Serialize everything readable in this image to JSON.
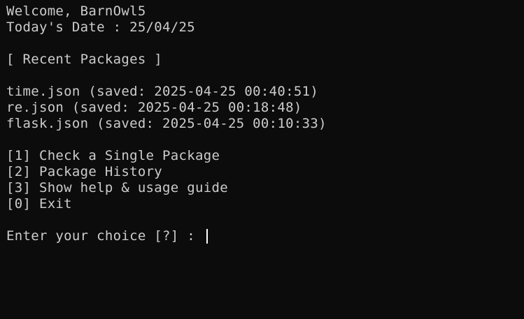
{
  "header": {
    "welcome": "Welcome, BarnOwl5",
    "date_line": "Today's Date : 25/04/25"
  },
  "recent": {
    "heading": "[ Recent Packages ]",
    "items": [
      "time.json (saved: 2025-04-25 00:40:51)",
      "re.json (saved: 2025-04-25 00:18:48)",
      "flask.json (saved: 2025-04-25 00:10:33)"
    ]
  },
  "menu": {
    "options": [
      "[1] Check a Single Package",
      "[2] Package History",
      "[3] Show help & usage guide",
      "[0] Exit"
    ]
  },
  "prompt": {
    "text": "Enter your choice [?] : "
  },
  "colors": {
    "background": "#0c0c0c",
    "foreground": "#cccccc",
    "cursor": "#ffffff"
  }
}
